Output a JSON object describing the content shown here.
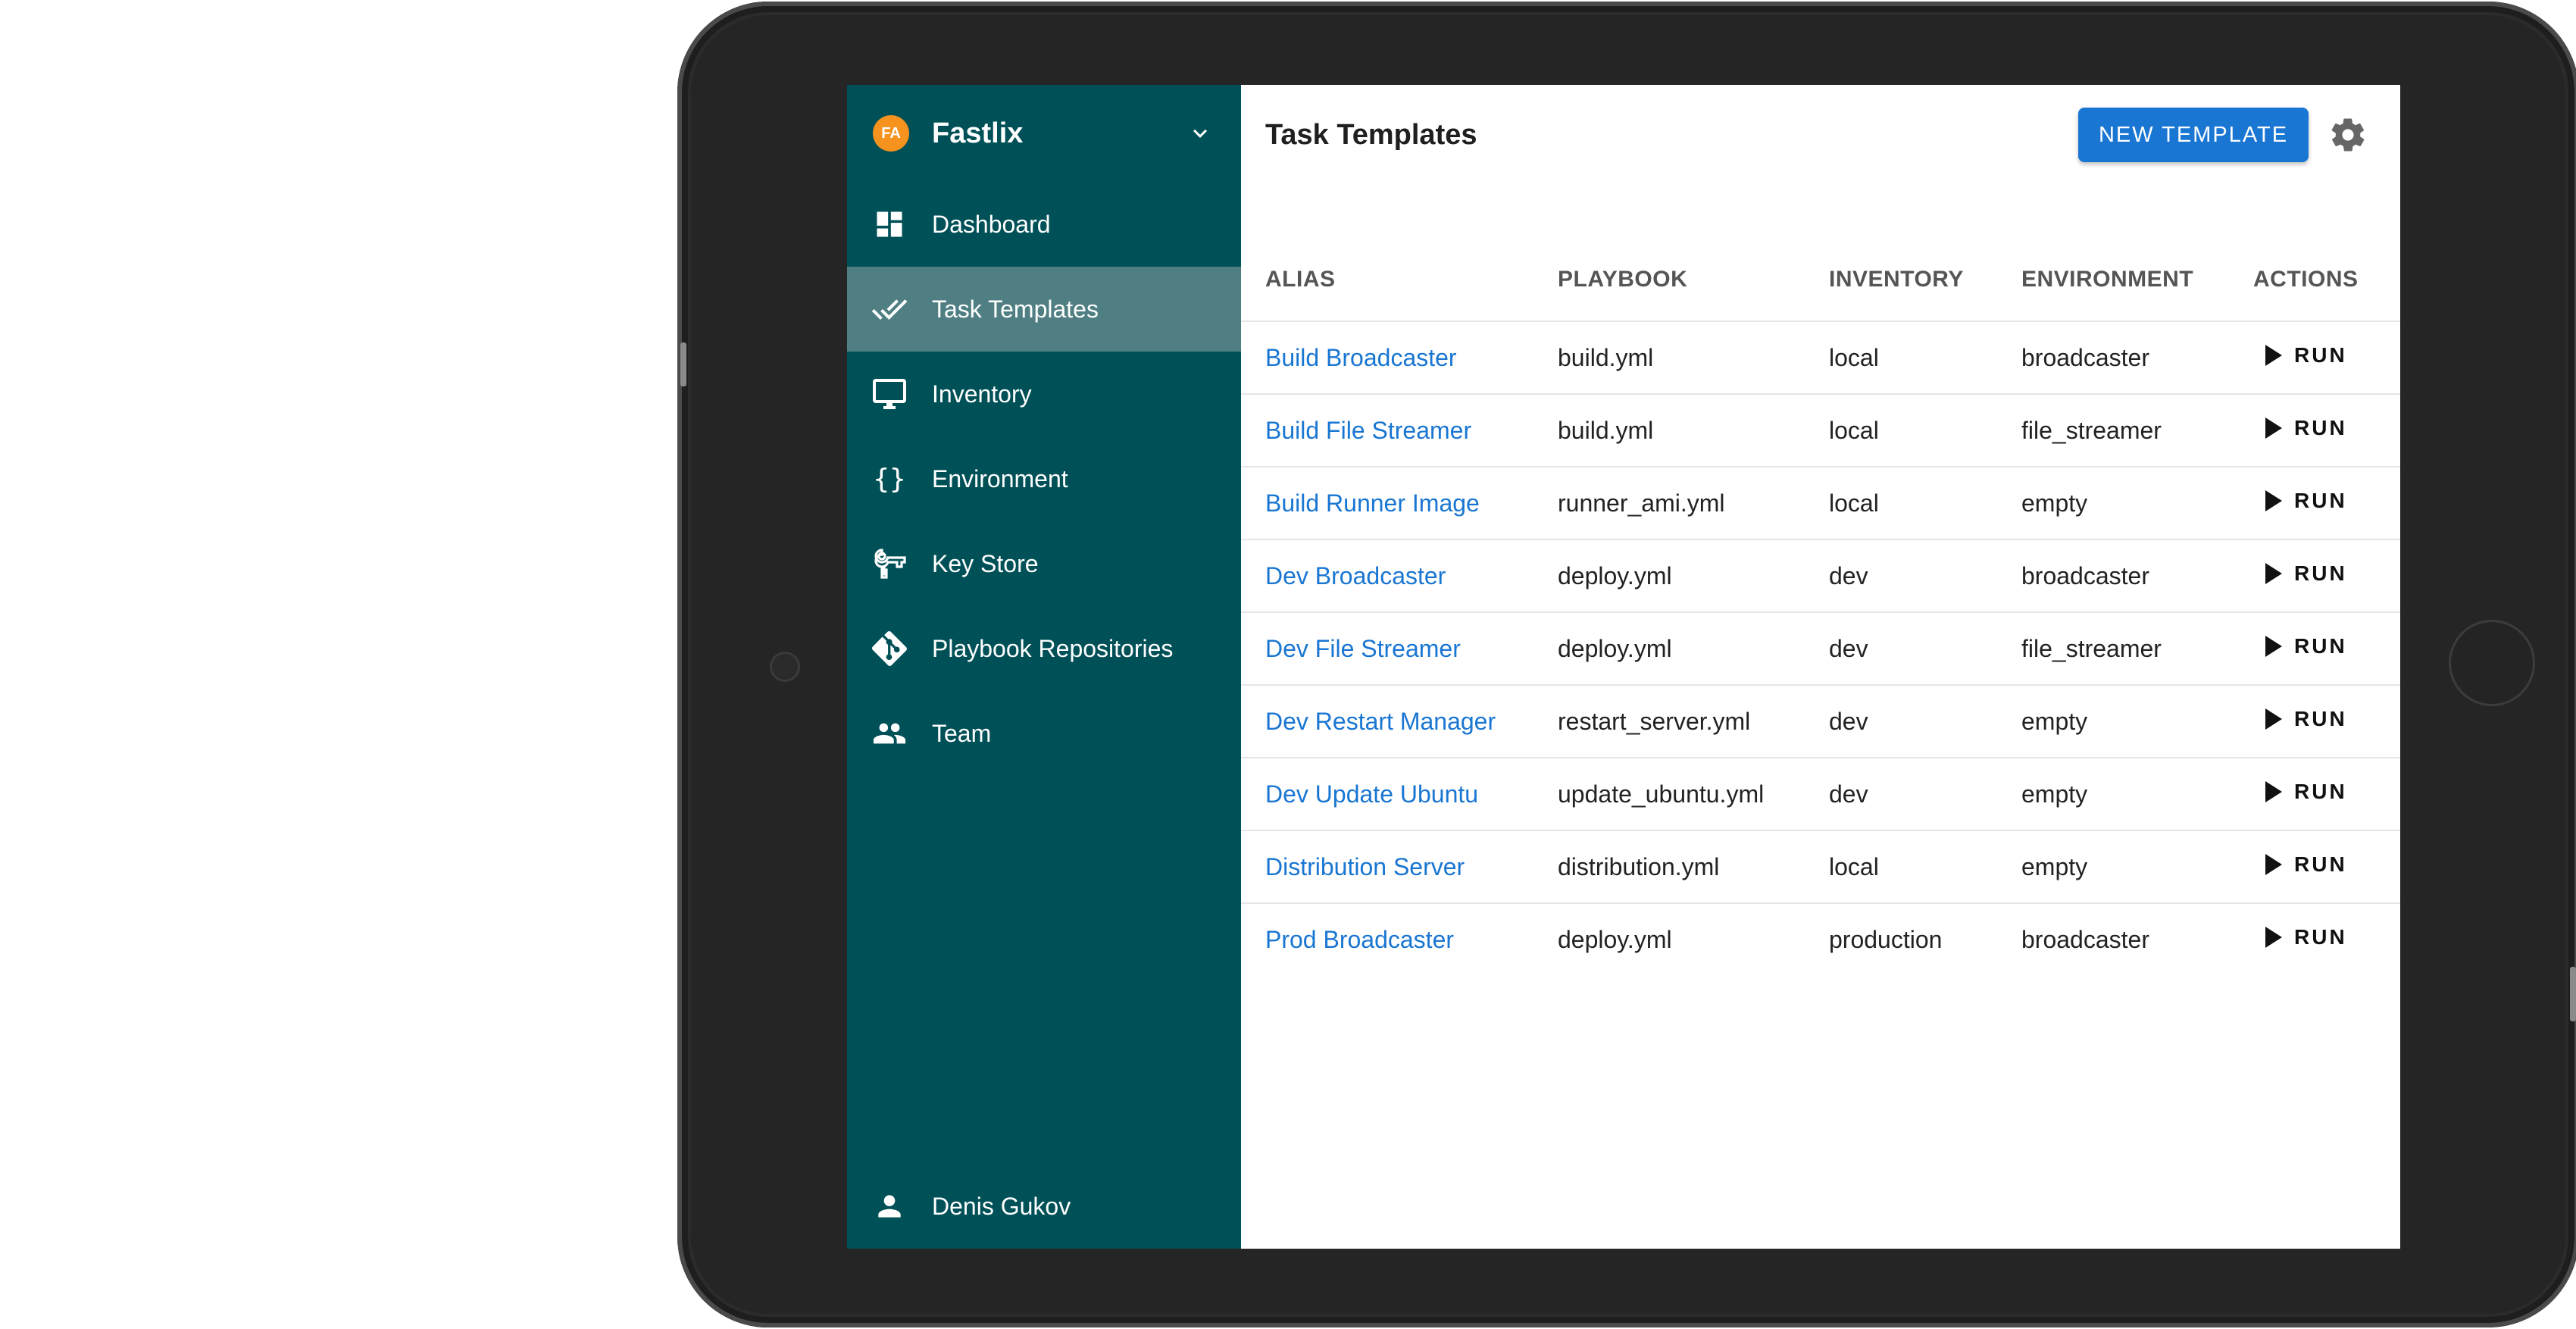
{
  "sidebar": {
    "brand": {
      "initials": "FA",
      "name": "Fastlix"
    },
    "items": [
      {
        "label": "Dashboard",
        "icon": "dashboard-icon",
        "active": false
      },
      {
        "label": "Task Templates",
        "icon": "double-check-icon",
        "active": true
      },
      {
        "label": "Inventory",
        "icon": "monitor-icon",
        "active": false
      },
      {
        "label": "Environment",
        "icon": "braces-icon",
        "active": false
      },
      {
        "label": "Key Store",
        "icon": "key-icon",
        "active": false
      },
      {
        "label": "Playbook Repositories",
        "icon": "git-icon",
        "active": false
      },
      {
        "label": "Team",
        "icon": "team-icon",
        "active": false
      }
    ],
    "user": {
      "name": "Denis Gukov",
      "icon": "person-icon"
    }
  },
  "header": {
    "title": "Task Templates",
    "new_template_label": "NEW TEMPLATE"
  },
  "table": {
    "columns": [
      "ALIAS",
      "PLAYBOOK",
      "INVENTORY",
      "ENVIRONMENT",
      "ACTIONS"
    ],
    "run_label": "RUN",
    "rows": [
      {
        "alias": "Build Broadcaster",
        "playbook": "build.yml",
        "inventory": "local",
        "environment": "broadcaster"
      },
      {
        "alias": "Build File Streamer",
        "playbook": "build.yml",
        "inventory": "local",
        "environment": "file_streamer"
      },
      {
        "alias": "Build Runner Image",
        "playbook": "runner_ami.yml",
        "inventory": "local",
        "environment": "empty"
      },
      {
        "alias": "Dev Broadcaster",
        "playbook": "deploy.yml",
        "inventory": "dev",
        "environment": "broadcaster"
      },
      {
        "alias": "Dev File Streamer",
        "playbook": "deploy.yml",
        "inventory": "dev",
        "environment": "file_streamer"
      },
      {
        "alias": "Dev Restart Manager",
        "playbook": "restart_server.yml",
        "inventory": "dev",
        "environment": "empty"
      },
      {
        "alias": "Dev Update Ubuntu",
        "playbook": "update_ubuntu.yml",
        "inventory": "dev",
        "environment": "empty"
      },
      {
        "alias": "Distribution Server",
        "playbook": "distribution.yml",
        "inventory": "local",
        "environment": "empty"
      },
      {
        "alias": "Prod Broadcaster",
        "playbook": "deploy.yml",
        "inventory": "production",
        "environment": "broadcaster"
      }
    ]
  },
  "colors": {
    "sidebar_bg": "#005057",
    "sidebar_active": "#4f7f83",
    "accent": "#1976d2",
    "brand_avatar": "#f6921e"
  }
}
